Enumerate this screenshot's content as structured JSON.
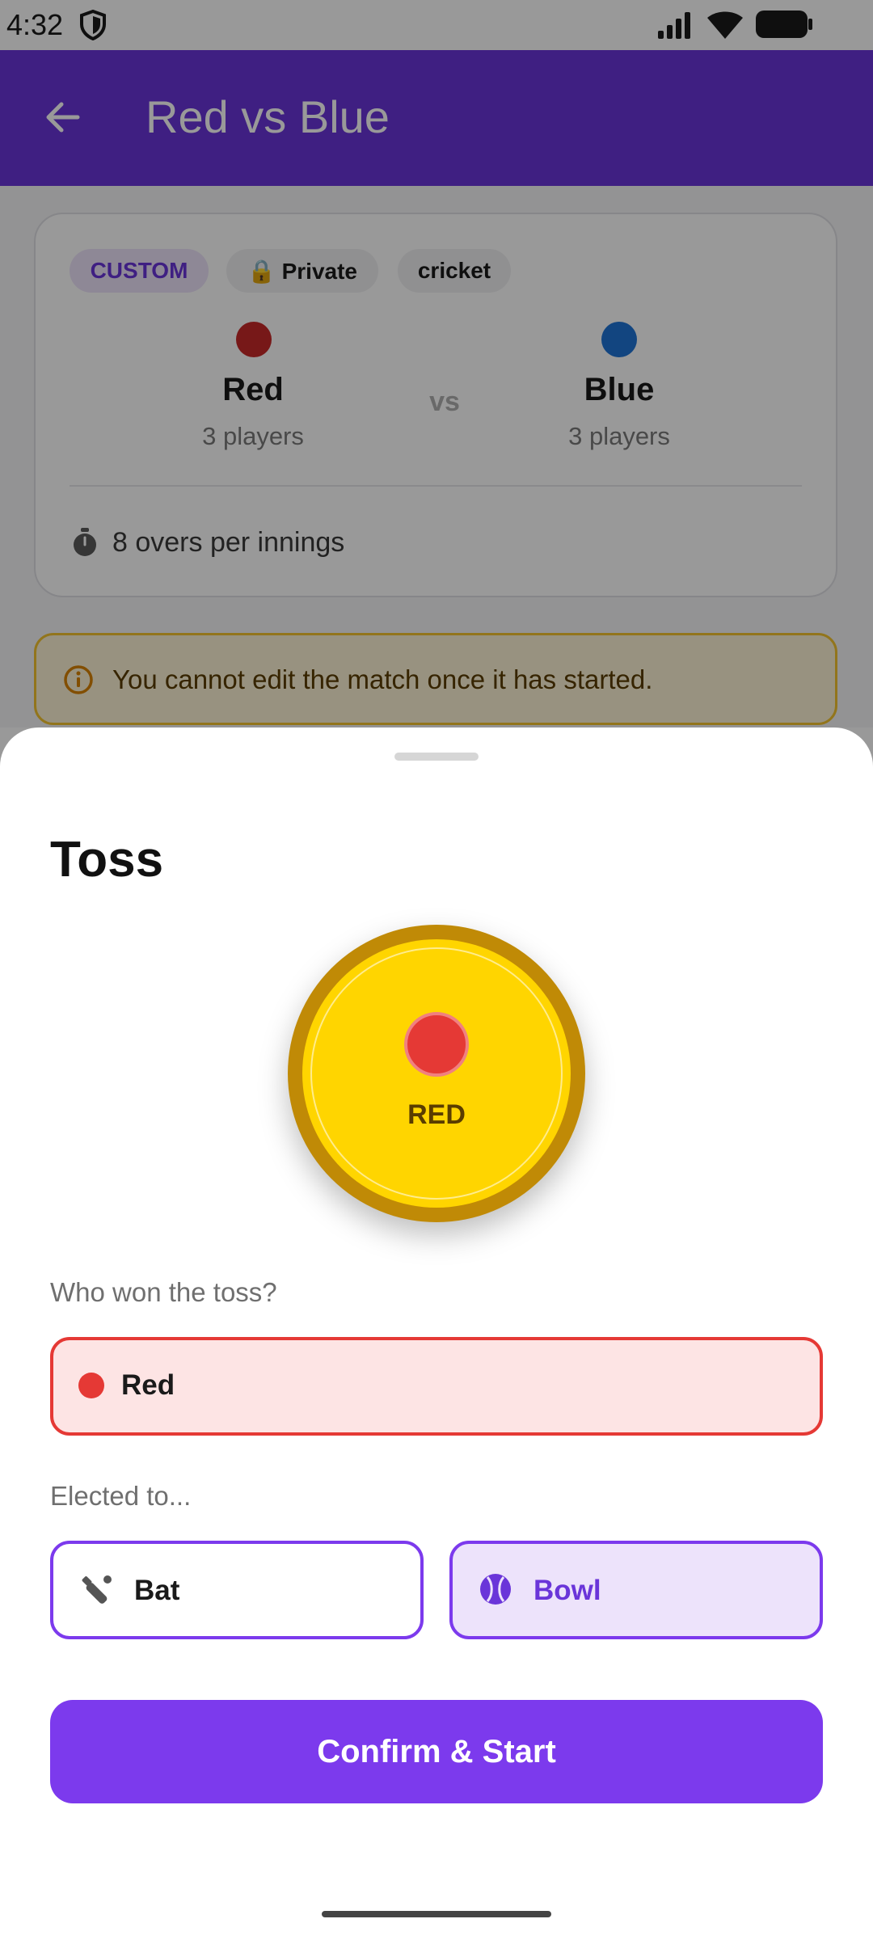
{
  "status_bar": {
    "time": "4:32"
  },
  "app_bar": {
    "title": "Red vs Blue",
    "back_icon": "arrow-left-icon"
  },
  "match_card": {
    "chips": [
      "CUSTOM",
      "🔒 Private",
      "cricket"
    ],
    "team_a": {
      "name": "Red",
      "players": "3 players",
      "color": "#c62828"
    },
    "vs": "vs",
    "team_b": {
      "name": "Blue",
      "players": "3 players",
      "color": "#1e74d6"
    },
    "overs": "8 overs per innings"
  },
  "warning": {
    "text": "You cannot edit the match once it has started."
  },
  "toss_sheet": {
    "title": "Toss",
    "coin_label": "RED",
    "winner_prompt": "Who won the toss?",
    "winner": "Red",
    "elected_prompt": "Elected to...",
    "options": [
      {
        "label": "Bat",
        "selected": false
      },
      {
        "label": "Bowl",
        "selected": true
      }
    ],
    "confirm_label": "Confirm & Start"
  },
  "colors": {
    "primary": "#7c3aed",
    "app_bar": "#6a35d9",
    "coin": "#ffd500",
    "coin_rim": "#c08a06",
    "red": "#e53935",
    "warning_border": "#f4c430"
  }
}
